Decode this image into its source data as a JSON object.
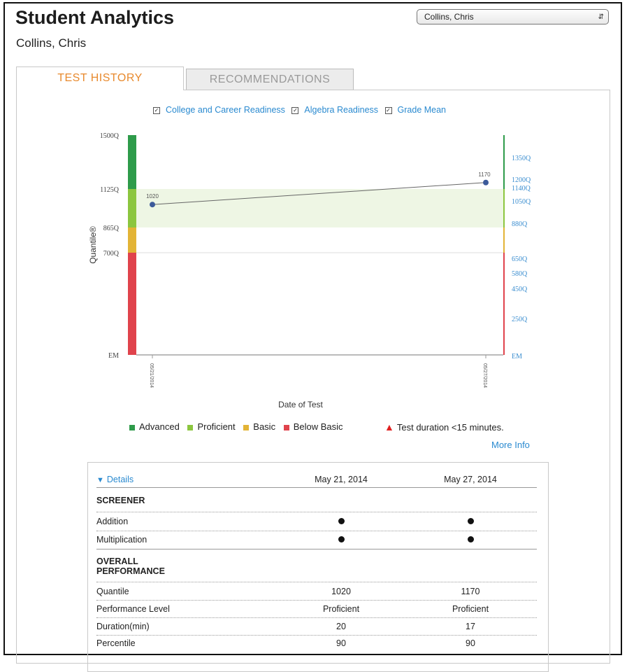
{
  "header": {
    "title": "Student Analytics",
    "student_name": "Collins, Chris"
  },
  "student_select": {
    "value": "Collins, Chris"
  },
  "tabs": [
    {
      "label": "TEST HISTORY",
      "active": true
    },
    {
      "label": "RECOMMENDATIONS",
      "active": false
    }
  ],
  "toggles": [
    {
      "label": "College and Career Readiness",
      "checked": true
    },
    {
      "label": "Algebra Readiness",
      "checked": true
    },
    {
      "label": "Grade Mean",
      "checked": true
    }
  ],
  "chart_data": {
    "type": "line",
    "ylabel": "Quantile®",
    "xlabel": "Date of Test",
    "left_axis_ticks": [
      "1500Q",
      "1125Q",
      "865Q",
      "700Q",
      "EM"
    ],
    "right_axis_ticks": [
      "1350Q",
      "1200Q",
      "1140Q",
      "1050Q",
      "880Q",
      "650Q",
      "580Q",
      "450Q",
      "250Q",
      "EM"
    ],
    "x_tick_labels": [
      "05/21/2014",
      "05/27/2014"
    ],
    "series": [
      {
        "values": [
          1020,
          1170
        ]
      }
    ],
    "data_labels": [
      "1020",
      "1170"
    ],
    "performance_bands": [
      {
        "name": "Advanced",
        "from": 1125,
        "to": 1500,
        "color": "#2e9b4a"
      },
      {
        "name": "Proficient",
        "from": 865,
        "to": 1125,
        "color": "#8cc63f"
      },
      {
        "name": "Basic",
        "from": 700,
        "to": 865,
        "color": "#e3b436"
      },
      {
        "name": "Below Basic",
        "from": 0,
        "to": 700,
        "color": "#e0434c"
      }
    ]
  },
  "legend": {
    "items": [
      {
        "label": "Advanced",
        "color": "#2e9b4a"
      },
      {
        "label": "Proficient",
        "color": "#8cc63f"
      },
      {
        "label": "Basic",
        "color": "#e3b436"
      },
      {
        "label": "Below Basic",
        "color": "#e0434c"
      }
    ],
    "warning": "Test duration <15 minutes.",
    "warning_icon": "warning-triangle-icon",
    "more_info": "More Info"
  },
  "details": {
    "toggle_label": "Details",
    "dates": [
      "May 21, 2014",
      "May 27, 2014"
    ],
    "screener_heading": "SCREENER",
    "screener_rows": [
      {
        "label": "Addition"
      },
      {
        "label": "Multiplication"
      }
    ],
    "overall_heading_1": "OVERALL",
    "overall_heading_2": "PERFORMANCE",
    "overall_rows": [
      {
        "label": "Quantile",
        "v1": "1020",
        "v2": "1170"
      },
      {
        "label": "Performance Level",
        "v1": "Proficient",
        "v2": "Proficient"
      },
      {
        "label": "Duration(min)",
        "v1": "20",
        "v2": "17"
      },
      {
        "label": "Percentile",
        "v1": "90",
        "v2": "90"
      }
    ]
  }
}
